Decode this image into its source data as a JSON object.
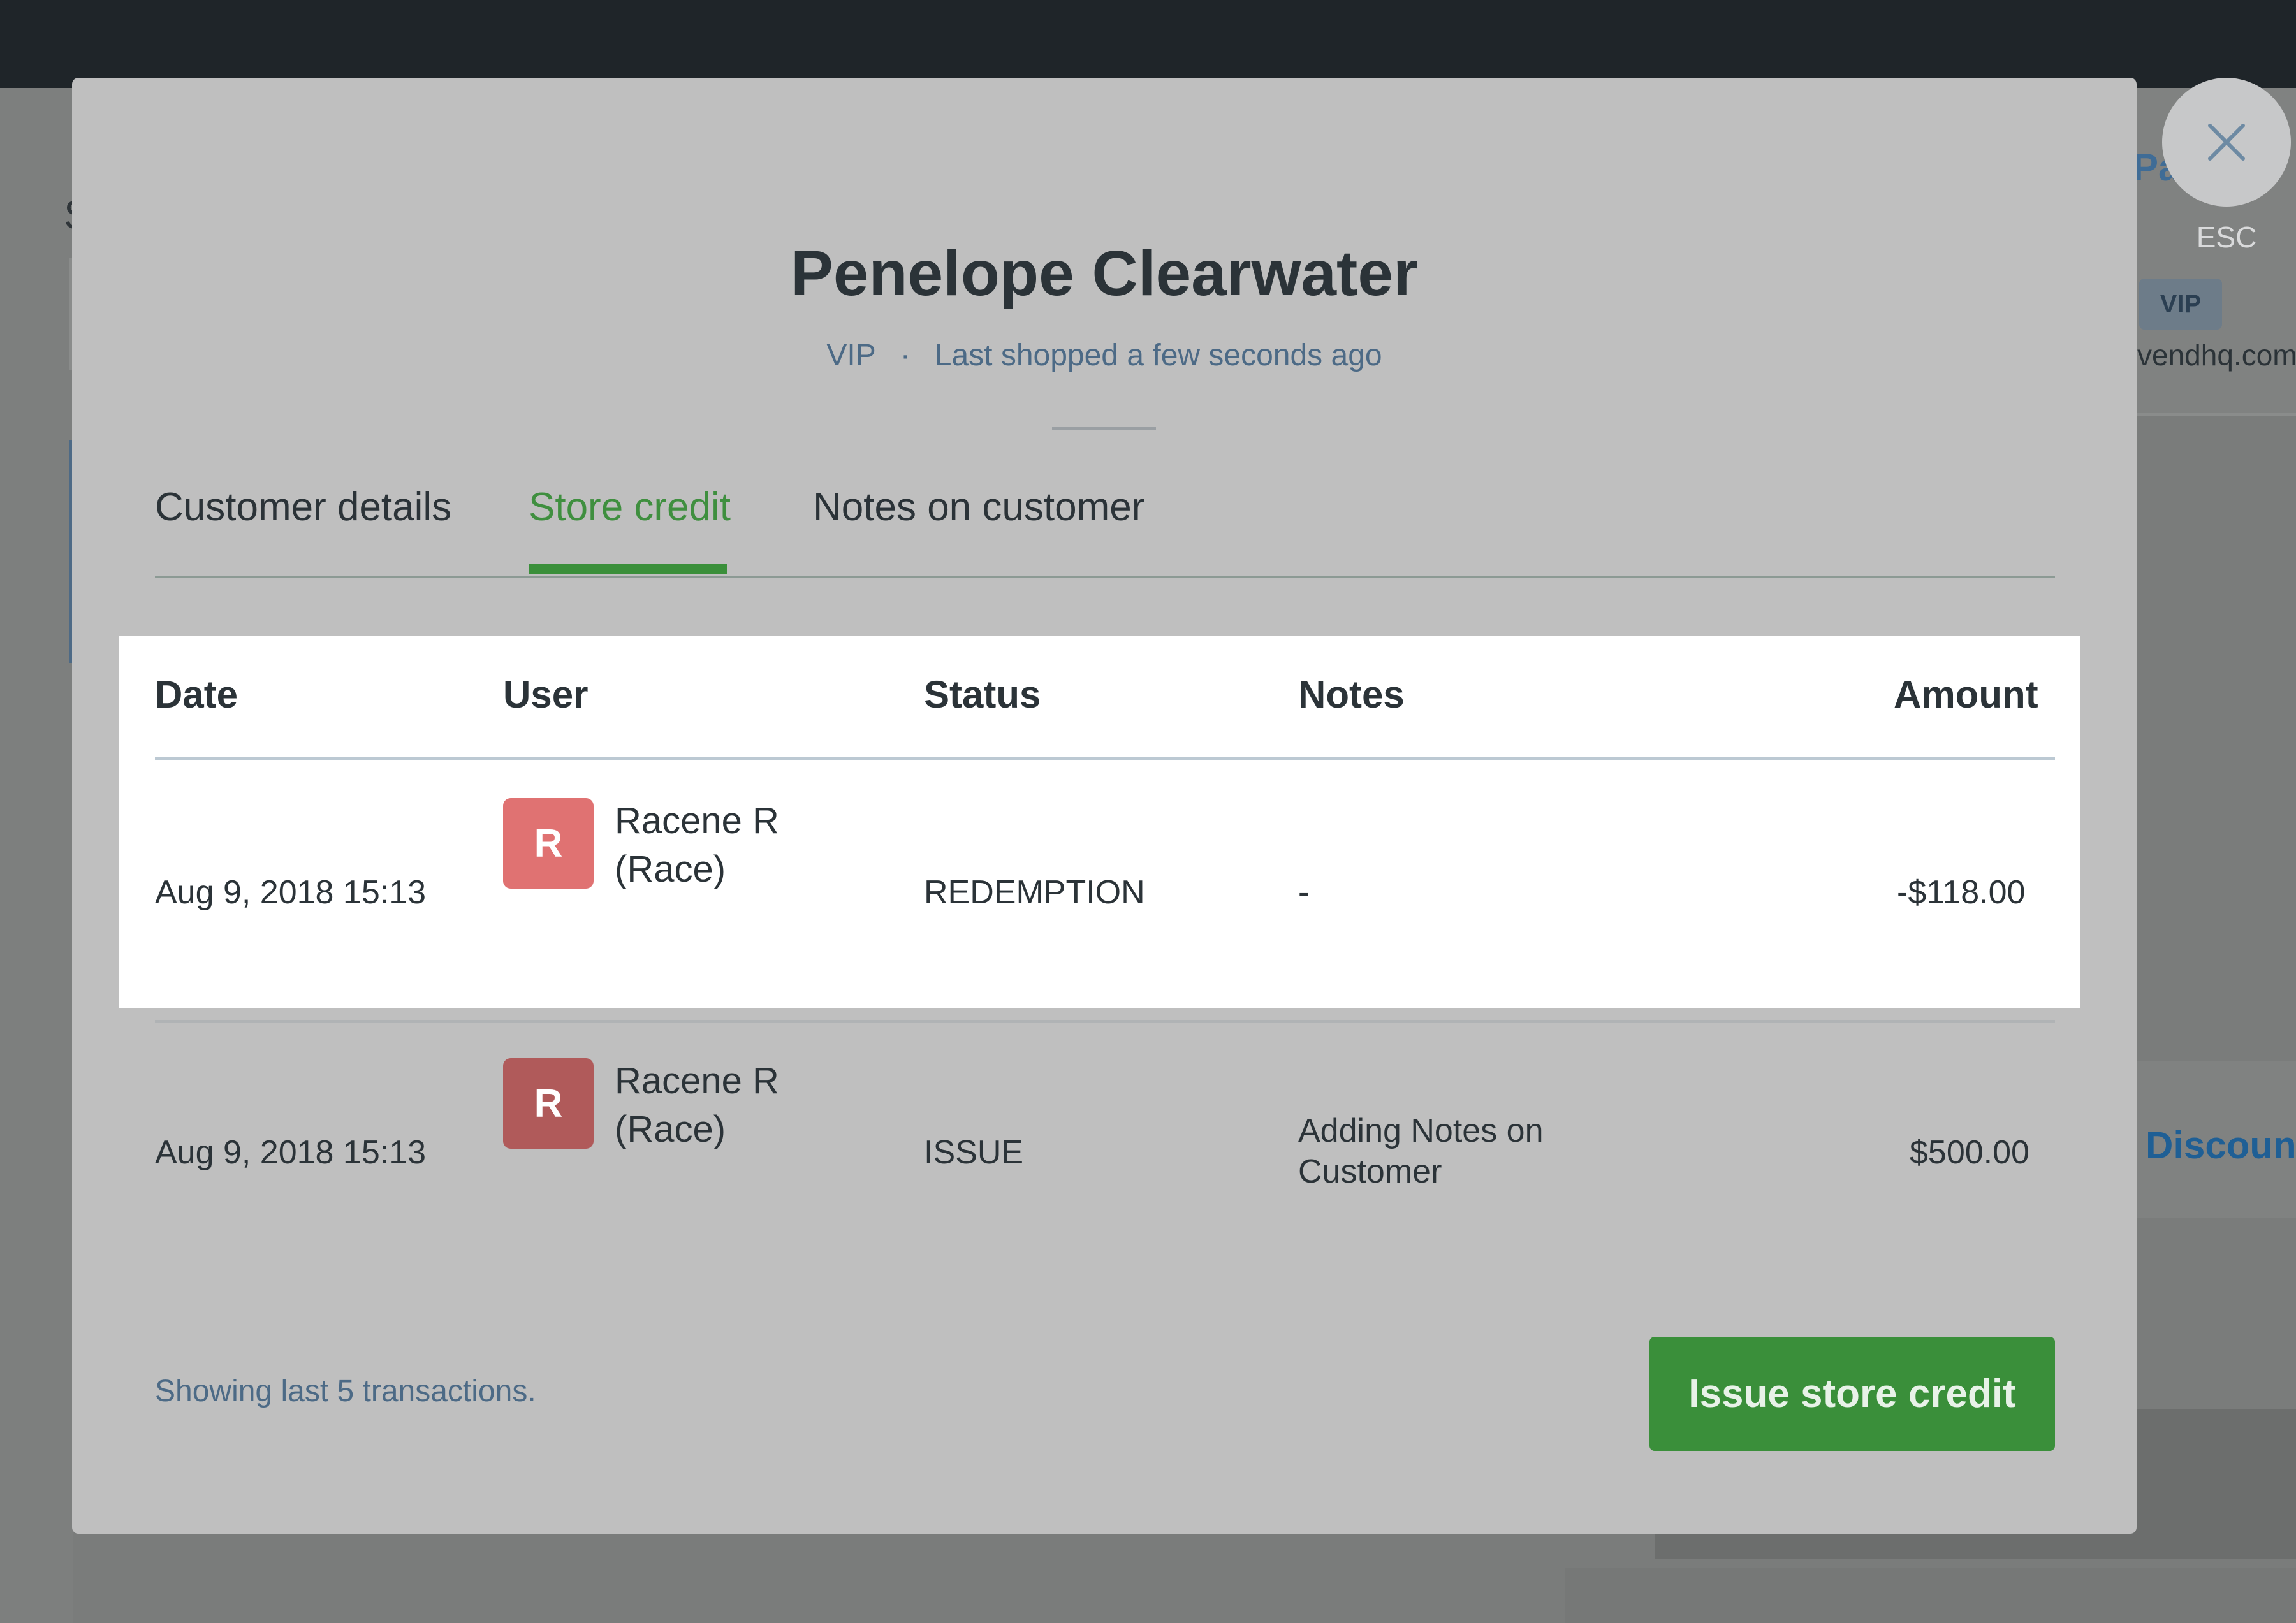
{
  "background": {
    "left_fragment": "S",
    "right_title_fragment": "Pa      e",
    "right_badge": "VIP",
    "right_email_fragment": "vendhq.com",
    "right_link": "Discount"
  },
  "modal": {
    "title": "Penelope Clearwater",
    "customer_group": "VIP",
    "separator": "·",
    "last_shopped": "Last shopped a few seconds ago",
    "tabs": [
      {
        "label": "Customer details",
        "active": false
      },
      {
        "label": "Store credit",
        "active": true
      },
      {
        "label": "Notes on customer",
        "active": false
      }
    ],
    "table": {
      "headers": {
        "date": "Date",
        "user": "User",
        "status": "Status",
        "notes": "Notes",
        "amount": "Amount"
      },
      "rows": [
        {
          "date": "Aug 9, 2018 15:13",
          "avatar_initial": "R",
          "user_name": "Racene R",
          "user_alias": "(Race)",
          "status": "REDEMPTION",
          "notes": "-",
          "amount": "-$118.00",
          "highlighted": true
        },
        {
          "date": "Aug 9, 2018 15:13",
          "avatar_initial": "R",
          "user_name": "Racene R",
          "user_alias": "(Race)",
          "status": "ISSUE",
          "notes_line1": "Adding Notes on",
          "notes_line2": "Customer",
          "amount": "$500.00",
          "highlighted": false
        }
      ]
    },
    "footer_note": "Showing last 5 transactions.",
    "issue_button": "Issue store credit"
  },
  "close": {
    "icon": "close-icon",
    "label": "ESC"
  },
  "colors": {
    "accent_green": "#3a8f3a",
    "avatar_active": "#e07272",
    "avatar_dimmed": "#b05a5a",
    "link_blue": "#4c6a86",
    "topbar": "#1f2529"
  }
}
